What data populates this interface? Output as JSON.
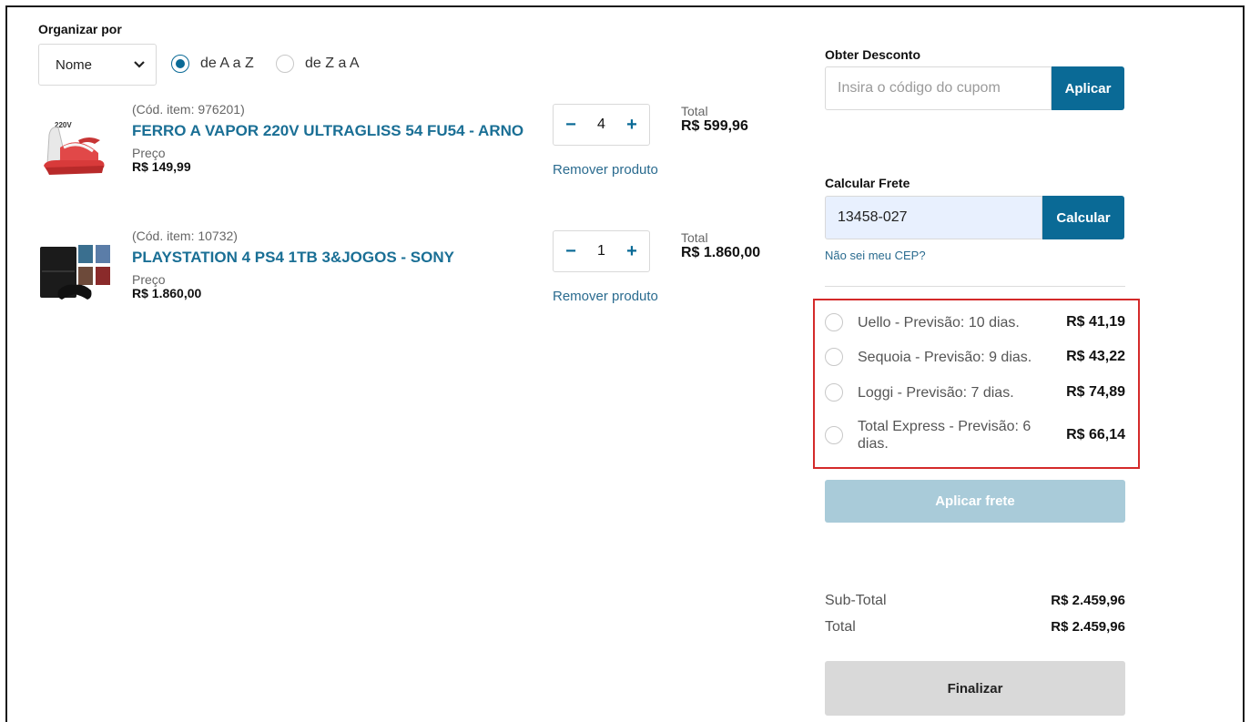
{
  "sort": {
    "label": "Organizar por",
    "select_value": "Nome",
    "options": [
      {
        "label": "de A a Z",
        "selected": true
      },
      {
        "label": "de Z a A",
        "selected": false
      }
    ]
  },
  "cart": {
    "items": [
      {
        "code": "(Cód. item: 976201)",
        "name": "FERRO A VAPOR 220V ULTRAGLISS 54 FU54 - ARNO",
        "price_label": "Preço",
        "price": "R$ 149,99",
        "quantity": "4",
        "remove_label": "Remover produto",
        "total_label": "Total",
        "total": "R$ 599,96",
        "image_text": "220V"
      },
      {
        "code": "(Cód. item: 10732)",
        "name": "PLAYSTATION 4 PS4 1TB 3&JOGOS - SONY",
        "price_label": "Preço",
        "price": "R$ 1.860,00",
        "quantity": "1",
        "remove_label": "Remover produto",
        "total_label": "Total",
        "total": "R$ 1.860,00"
      }
    ]
  },
  "discount": {
    "heading": "Obter Desconto",
    "placeholder": "Insira o código do cupom",
    "button": "Aplicar"
  },
  "freight": {
    "heading": "Calcular Frete",
    "cep_value": "13458-027",
    "button": "Calcular",
    "help_link": "Não sei meu CEP?",
    "options": [
      {
        "name": "Uello - Previsão: 10 dias.",
        "price": "R$ 41,19"
      },
      {
        "name": "Sequoia - Previsão: 9 dias.",
        "price": "R$ 43,22"
      },
      {
        "name": "Loggi - Previsão: 7 dias.",
        "price": "R$ 74,89"
      },
      {
        "name": "Total Express - Previsão: 6 dias.",
        "price": "R$ 66,14"
      }
    ],
    "apply_button": "Aplicar frete"
  },
  "summary": {
    "subtotal_label": "Sub-Total",
    "subtotal": "R$ 2.459,96",
    "total_label": "Total",
    "total": "R$ 2.459,96",
    "finish_button": "Finalizar"
  },
  "colors": {
    "accent": "#0a6a96",
    "link": "#1a6f95",
    "highlight_border": "#d42a2a",
    "disabled_button": "#a9cbd9"
  }
}
